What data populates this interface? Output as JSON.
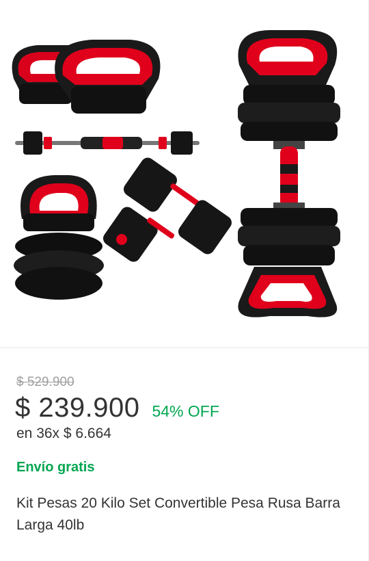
{
  "product": {
    "image_alt": "Kit de pesas convertible: kettlebells, barra larga y mancuernas",
    "old_price": "$ 529.900",
    "price": "$ 239.900",
    "discount": "54% OFF",
    "installments": "en 36x $ 6.664",
    "shipping": "Envío gratis",
    "title": "Kit Pesas 20 Kilo Set Convertible Pesa Rusa Barra Larga 40lb"
  },
  "colors": {
    "accent_green": "#00a650",
    "text_primary": "#333333",
    "text_muted": "#9e9e9e",
    "product_red": "#e0001b",
    "product_black": "#1a1a1a"
  }
}
